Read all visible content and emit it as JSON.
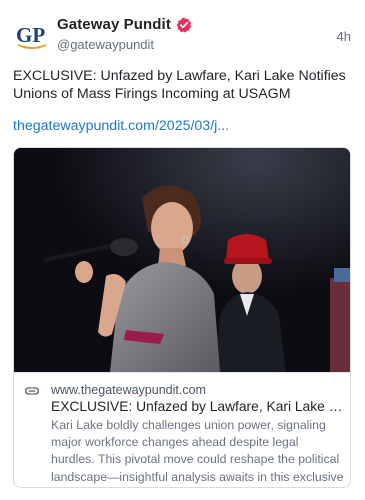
{
  "author": {
    "display_name": "Gateway Pundit",
    "handle": "@gatewaypundit",
    "avatar_text": "GP",
    "verified_icon": "verified-badge-icon",
    "accent_color": "#e8305a"
  },
  "post": {
    "time": "4h",
    "text": "EXCLUSIVE: Unfazed by Lawfare, Kari Lake Notifies Unions of Mass Firings Incoming at USAGM",
    "link_text": "thegatewaypundit.com/2025/03/j...",
    "link_color": "#1d78c8"
  },
  "card": {
    "domain": "www.thegatewaypundit.com",
    "title": "EXCLUSIVE: Unfazed by Lawfare, Kari Lake No...",
    "description": "Kari Lake boldly challenges union power, signaling major workforce changes ahead despite legal hurdles. This pivotal move could reshape the political landscape—insightful analysis awaits in this exclusive report.",
    "image_icon": "news-photo-image",
    "link_icon": "chain-link-icon"
  }
}
